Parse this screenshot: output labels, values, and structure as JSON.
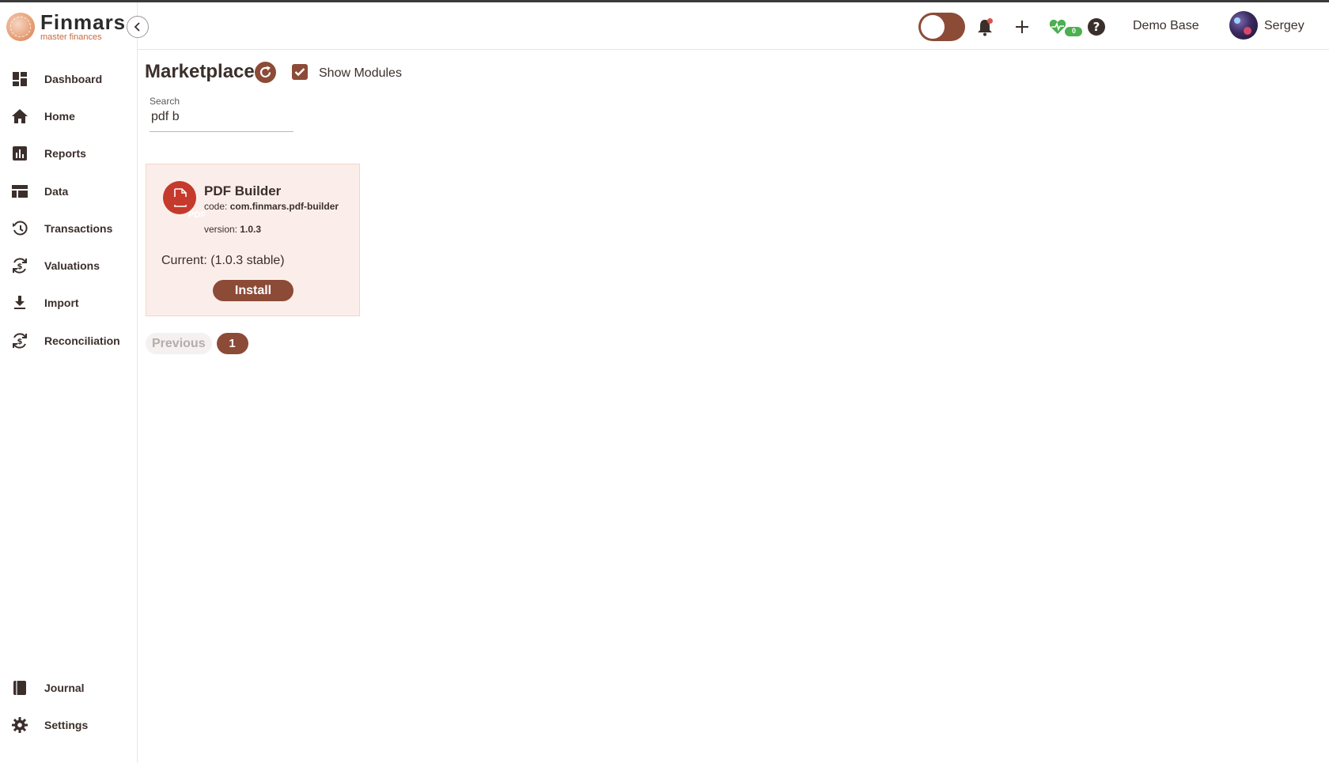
{
  "brand": {
    "name": "Finmars",
    "tagline": "master finances"
  },
  "colors": {
    "accent": "#8c4b37",
    "card_bg": "#fbeeea",
    "pdf_red": "#c53a2c",
    "health_green": "#4caf50"
  },
  "sidebar": {
    "items": [
      {
        "label": "Dashboard",
        "icon": "dashboard-icon"
      },
      {
        "label": "Home",
        "icon": "home-icon"
      },
      {
        "label": "Reports",
        "icon": "bar-chart-icon"
      },
      {
        "label": "Data",
        "icon": "table-icon"
      },
      {
        "label": "Transactions",
        "icon": "history-icon"
      },
      {
        "label": "Valuations",
        "icon": "currency-refresh-icon"
      },
      {
        "label": "Import",
        "icon": "download-icon"
      },
      {
        "label": "Reconciliation",
        "icon": "currency-refresh-icon"
      }
    ],
    "bottom_items": [
      {
        "label": "Journal",
        "icon": "book-icon"
      },
      {
        "label": "Settings",
        "icon": "gear-icon"
      }
    ]
  },
  "header": {
    "health_count": "0",
    "base_name": "Demo Base",
    "user_name": "Sergey"
  },
  "main": {
    "title": "Marketplace",
    "show_modules_label": "Show Modules",
    "show_modules_checked": true,
    "search": {
      "label": "Search",
      "value": "pdf b"
    },
    "cards": [
      {
        "title": "PDF Builder",
        "icon_text": "PDF",
        "code_label": "code:",
        "code_value": "com.finmars.pdf-builder",
        "version_label": "version:",
        "version_value": "1.0.3",
        "current": "Current: (1.0.3 stable)",
        "action_label": "Install"
      }
    ],
    "pagination": {
      "previous_label": "Previous",
      "current_page": "1"
    }
  }
}
